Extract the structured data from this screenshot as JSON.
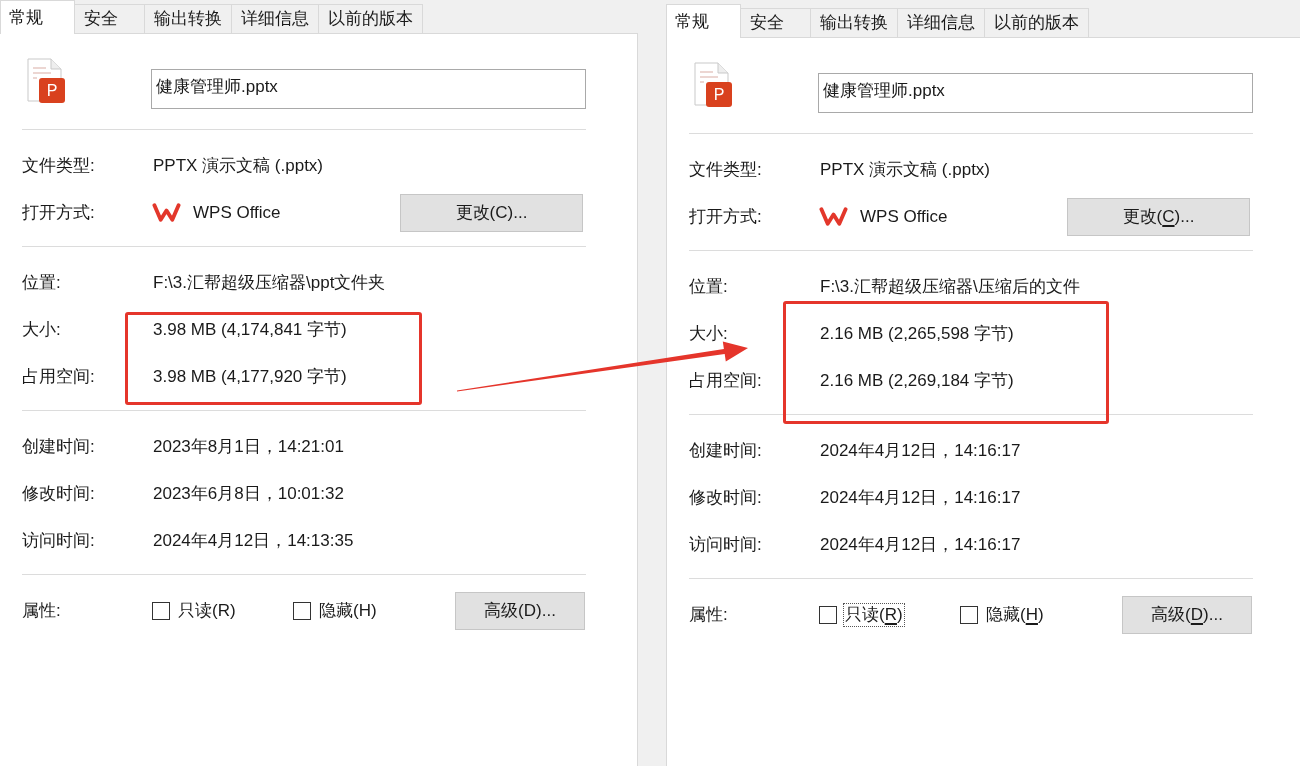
{
  "panels": [
    {
      "tabs": [
        {
          "label": "常规",
          "selected": true
        },
        {
          "label": "安全",
          "selected": false
        },
        {
          "label": "输出转换",
          "selected": false
        },
        {
          "label": "详细信息",
          "selected": false
        },
        {
          "label": "以前的版本",
          "selected": false
        }
      ],
      "file_icon": {
        "letter": "P"
      },
      "file_name": "健康管理师.pptx",
      "access_keys_underlined": false,
      "file_type": {
        "label": "文件类型:",
        "value": "PPTX 演示文稿 (.pptx)"
      },
      "opens_with": {
        "label": "打开方式:",
        "app": "WPS Office",
        "button": {
          "text_before": "更改(",
          "access_key": "C",
          "text_after": ")..."
        }
      },
      "location": {
        "label": "位置:",
        "value": "F:\\3.汇帮超级压缩器\\ppt文件夹"
      },
      "size": {
        "label": "大小:",
        "value": "3.98 MB (4,174,841 字节)"
      },
      "size_on_disk": {
        "label": "占用空间:",
        "value": "3.98 MB (4,177,920 字节)"
      },
      "sizes_highlighted": true,
      "created": {
        "label": "创建时间:",
        "value": "2023年8月1日，14:21:01"
      },
      "modified": {
        "label": "修改时间:",
        "value": "2023年6月8日，10:01:32"
      },
      "accessed": {
        "label": "访问时间:",
        "value": "2024年4月12日，14:13:35"
      },
      "attributes": {
        "label": "属性:",
        "checkboxes": [
          {
            "text_before": "只读(",
            "access_key": "R",
            "text_after": ")",
            "checked": false,
            "focused": false
          },
          {
            "text_before": "隐藏(",
            "access_key": "H",
            "text_after": ")",
            "checked": false,
            "focused": false
          }
        ],
        "button": {
          "text_before": "高级(",
          "access_key": "D",
          "text_after": ")..."
        }
      }
    },
    {
      "tabs": [
        {
          "label": "常规",
          "selected": true
        },
        {
          "label": "安全",
          "selected": false
        },
        {
          "label": "输出转换",
          "selected": false
        },
        {
          "label": "详细信息",
          "selected": false
        },
        {
          "label": "以前的版本",
          "selected": false
        }
      ],
      "file_icon": {
        "letter": "P"
      },
      "file_name": "健康管理师.pptx",
      "access_keys_underlined": true,
      "file_type": {
        "label": "文件类型:",
        "value": "PPTX 演示文稿 (.pptx)"
      },
      "opens_with": {
        "label": "打开方式:",
        "app": "WPS Office",
        "button": {
          "text_before": "更改(",
          "access_key": "C",
          "text_after": ")..."
        }
      },
      "location": {
        "label": "位置:",
        "value": "F:\\3.汇帮超级压缩器\\压缩后的文件"
      },
      "size": {
        "label": "大小:",
        "value": "2.16 MB (2,265,598 字节)"
      },
      "size_on_disk": {
        "label": "占用空间:",
        "value": "2.16 MB (2,269,184 字节)"
      },
      "sizes_highlighted": true,
      "created": {
        "label": "创建时间:",
        "value": "2024年4月12日，14:16:17"
      },
      "modified": {
        "label": "修改时间:",
        "value": "2024年4月12日，14:16:17"
      },
      "accessed": {
        "label": "访问时间:",
        "value": "2024年4月12日，14:16:17"
      },
      "attributes": {
        "label": "属性:",
        "checkboxes": [
          {
            "text_before": "只读(",
            "access_key": "R",
            "text_after": ")",
            "checked": false,
            "focused": true
          },
          {
            "text_before": "隐藏(",
            "access_key": "H",
            "text_after": ")",
            "checked": false,
            "focused": false
          }
        ],
        "button": {
          "text_before": "高级(",
          "access_key": "D",
          "text_after": ")..."
        }
      }
    }
  ],
  "comparison_arrow": true
}
